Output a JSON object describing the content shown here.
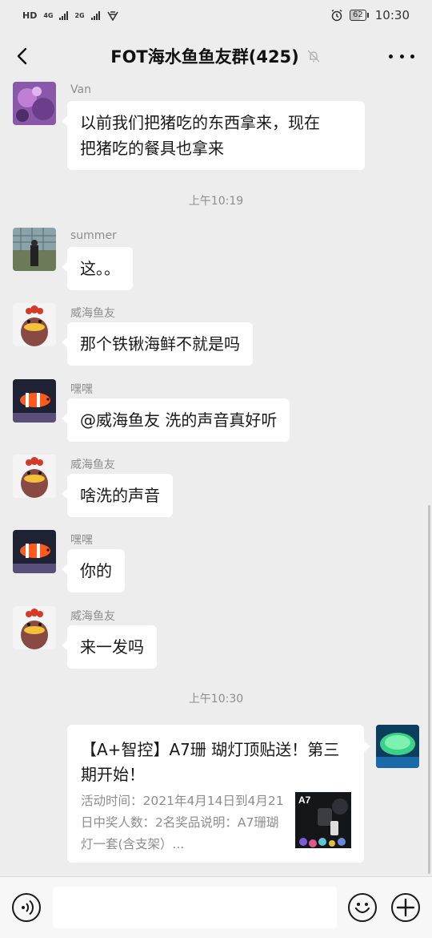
{
  "status_bar": {
    "left_label": "HD",
    "net1": "4G",
    "net2": "2G",
    "time": "10:30",
    "battery": "62"
  },
  "header": {
    "title": "FOT海水鱼鱼友群(425)"
  },
  "messages": [
    {
      "sender": "Van",
      "text_lines": [
        "以前我们把猪吃的东西拿来，现在",
        "把猪吃的餐具也拿来"
      ]
    },
    {
      "sender": "summer",
      "text": "这。。"
    },
    {
      "sender": "威海鱼友",
      "text": "那个铁锹海鲜不就是吗"
    },
    {
      "sender": "嘿嘿",
      "text": "@威海鱼友  洗的声音真好听"
    },
    {
      "sender": "威海鱼友",
      "text": "啥洗的声音"
    },
    {
      "sender": "嘿嘿",
      "text": "你的"
    },
    {
      "sender": "威海鱼友",
      "text": "来一发吗"
    }
  ],
  "timestamps": [
    "上午10:19",
    "上午10:30"
  ],
  "link_card": {
    "title": "【A+智控】A7珊 瑚灯顶贴送！第三期开始！",
    "description": "活动时间：2021年4月14日到4月21日中奖人数：2名奖品说明：A7珊瑚灯一套(含支架）...",
    "thumb_label": "A7"
  },
  "input": {
    "placeholder": ""
  },
  "colors": {
    "background": "#ededed",
    "bubble": "#ffffff",
    "meta_text": "#8d8d8d"
  }
}
